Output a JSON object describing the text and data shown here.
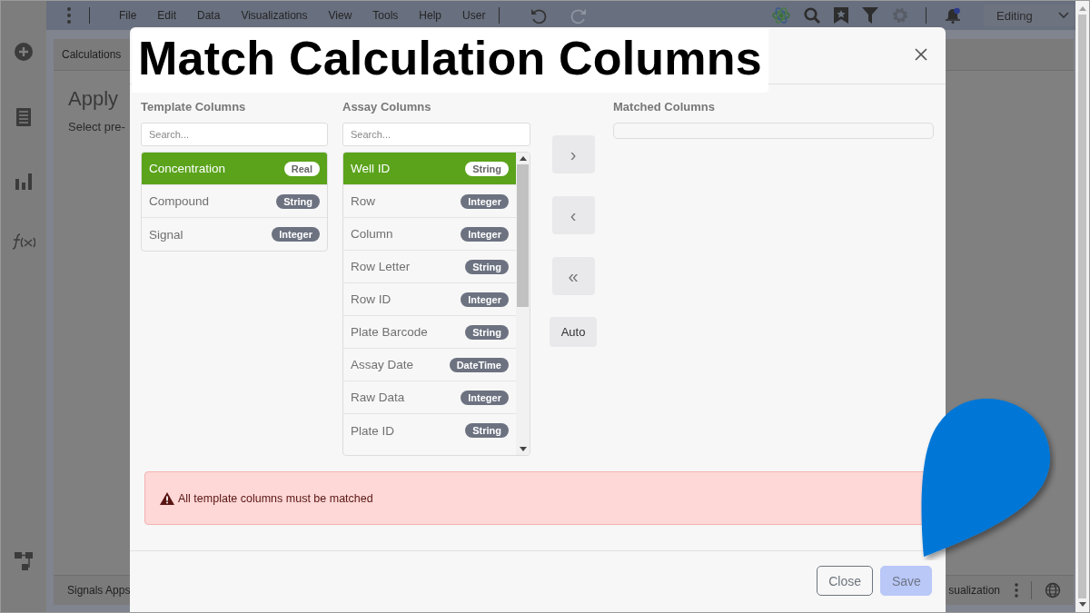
{
  "app": {
    "menu": [
      "File",
      "Edit",
      "Data",
      "Visualizations",
      "View",
      "Tools",
      "Help",
      "User"
    ],
    "history": [
      {
        "kind": "undo",
        "disabled": false
      },
      {
        "kind": "redo",
        "disabled": true
      }
    ],
    "mode": "Editing",
    "notifications": true,
    "tab": "Calculations",
    "panel_title": "Apply",
    "panel_text": "Select pre-",
    "footer_left": "Signals Apps",
    "footer_right": "sualization"
  },
  "dialog": {
    "title": "Match Calculation Columns",
    "template": {
      "label": "Template Columns",
      "placeholder": "Search...",
      "items": [
        {
          "name": "Concentration",
          "type": "Real",
          "selected": true
        },
        {
          "name": "Compound",
          "type": "String",
          "selected": false
        },
        {
          "name": "Signal",
          "type": "Integer",
          "selected": false
        }
      ]
    },
    "assay": {
      "label": "Assay Columns",
      "placeholder": "Search...",
      "items": [
        {
          "name": "Well ID",
          "type": "String",
          "selected": true
        },
        {
          "name": "Row",
          "type": "Integer",
          "selected": false
        },
        {
          "name": "Column",
          "type": "Integer",
          "selected": false
        },
        {
          "name": "Row Letter",
          "type": "String",
          "selected": false
        },
        {
          "name": "Row ID",
          "type": "Integer",
          "selected": false
        },
        {
          "name": "Plate Barcode",
          "type": "String",
          "selected": false
        },
        {
          "name": "Assay Date",
          "type": "DateTime",
          "selected": false
        },
        {
          "name": "Raw Data",
          "type": "Integer",
          "selected": false
        },
        {
          "name": "Plate ID",
          "type": "String",
          "selected": false
        }
      ]
    },
    "move_buttons": [
      "›",
      "‹",
      "«"
    ],
    "auto_button": "Auto",
    "matched": {
      "label": "Matched Columns"
    },
    "alert": "All template columns must be matched",
    "buttons": [
      {
        "label": "Close",
        "kind": "secondary",
        "disabled": false
      },
      {
        "label": "Save",
        "kind": "primary",
        "disabled": true
      }
    ]
  }
}
